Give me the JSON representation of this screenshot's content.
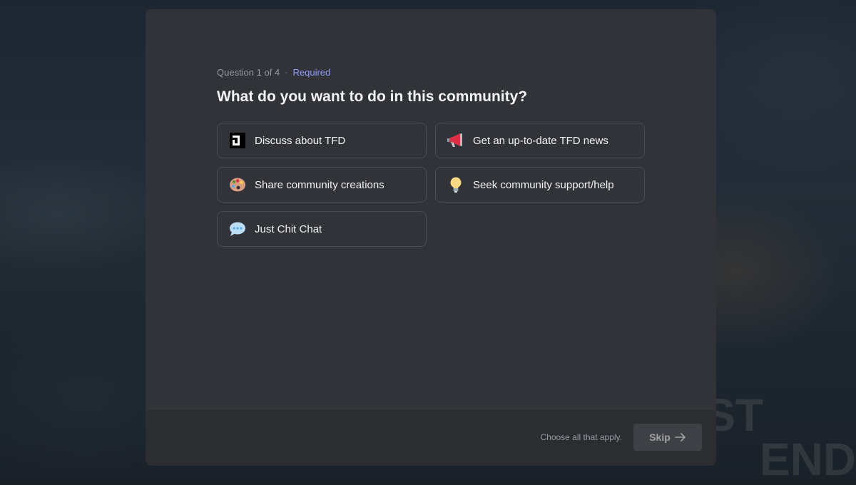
{
  "background": {
    "text_lines": [
      "ST",
      "END"
    ]
  },
  "modal": {
    "question_counter": "Question 1 of 4",
    "separator": "·",
    "required_label": "Required",
    "title": "What do you want to do in this community?",
    "options": [
      {
        "label": "Discuss about TFD",
        "icon": "tfd-logo-icon"
      },
      {
        "label": "Get an up-to-date TFD news",
        "icon": "megaphone-icon"
      },
      {
        "label": "Share community creations",
        "icon": "palette-icon"
      },
      {
        "label": "Seek community support/help",
        "icon": "lightbulb-icon"
      },
      {
        "label": "Just Chit Chat",
        "icon": "speech-balloon-icon"
      }
    ],
    "footer": {
      "hint": "Choose all that apply.",
      "skip_label": "Skip",
      "skip_icon": "arrow-right-icon"
    }
  },
  "colors": {
    "modal_bg": "#313338",
    "footer_bg": "#2b2d31",
    "required": "#949cf7",
    "option_border": "#4a4c53"
  }
}
